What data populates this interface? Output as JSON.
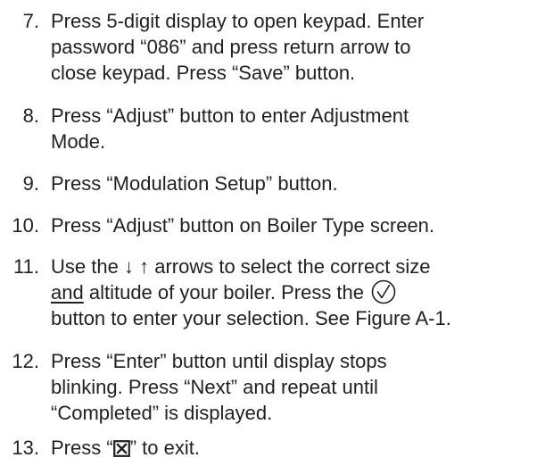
{
  "steps": [
    {
      "number": "7.",
      "lines": [
        "Press 5-digit display to open keypad. Enter",
        "password “086” and press return arrow to",
        "close keypad. Press “Save” button."
      ]
    },
    {
      "number": "8.",
      "lines": [
        "Press “Adjust” button to enter Adjustment",
        "Mode."
      ]
    },
    {
      "number": "9.",
      "lines": [
        "Press “Modulation Setup” button."
      ]
    },
    {
      "number": "10.",
      "lines": [
        "Press “Adjust” button on Boiler Type screen."
      ]
    },
    {
      "number": "11.",
      "line1_a": "Use the",
      "line1_arrows": "↓  ↑",
      "line1_b": "arrows to select the correct size",
      "line2_underlined": "and",
      "line2_b": "altitude of your boiler. Press the",
      "line2_icon": "check-circle-icon",
      "line3": "button to enter your selection. See Figure A-1."
    },
    {
      "number": "12.",
      "lines": [
        "Press “Enter” button until display stops",
        "blinking. Press “Next” and repeat until",
        "“Completed” is displayed."
      ]
    },
    {
      "number": "13.",
      "before": "Press “",
      "icon": "close-box-icon",
      "after": "” to exit."
    }
  ]
}
